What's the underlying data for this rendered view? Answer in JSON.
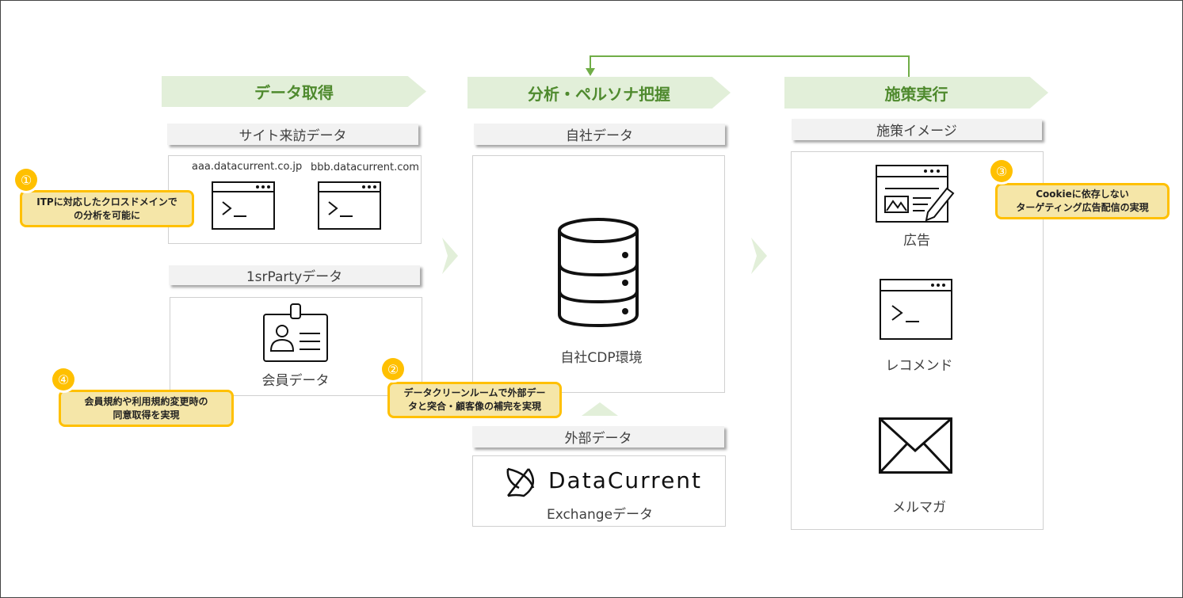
{
  "stages": [
    "データ取得",
    "分析・ペルソナ把握",
    "施策実行"
  ],
  "sections": {
    "site_visit": "サイト来訪データ",
    "first_party": "1srPartyデータ",
    "own_data": "自社データ",
    "external": "外部データ",
    "measures": "施策イメージ"
  },
  "domains": [
    "aaa.datacurrent.co.jp",
    "bbb.datacurrent.com"
  ],
  "labels": {
    "member": "会員データ",
    "cdp": "自社CDP環境",
    "ad": "広告",
    "recommend": "レコメンド",
    "mailmag": "メルマガ",
    "exchange": "Exchangeデータ"
  },
  "logo_text": "DataCurrent",
  "callouts": [
    {
      "num": "①",
      "text": "ITPに対応したクロスドメインで\nの分析を可能に"
    },
    {
      "num": "②",
      "text": "データクリーンルームで外部デー\nタと突合・顧客像の補完を実現"
    },
    {
      "num": "③",
      "text": "Cookieに依存しない\nターゲティング広告配信の実現"
    },
    {
      "num": "④",
      "text": "会員規約や利用規約変更時の\n同意取得を実現"
    }
  ],
  "colors": {
    "accent_green": "#70ad47",
    "stage_fill": "#e2efd9",
    "callout_fill": "#f5e6a8",
    "callout_border": "#ffc000"
  }
}
